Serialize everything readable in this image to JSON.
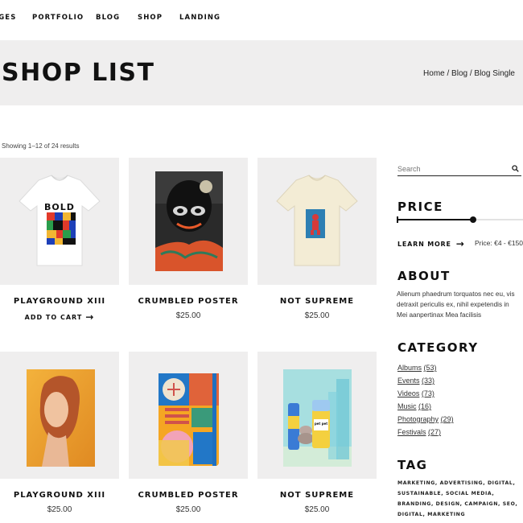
{
  "nav": {
    "items": [
      {
        "label": "PAGES"
      },
      {
        "label": "PORTFOLIO"
      },
      {
        "label": "BLOG"
      },
      {
        "label": "SHOP"
      },
      {
        "label": "LANDING"
      }
    ]
  },
  "hero": {
    "title": "SHOP LIST",
    "breadcrumb": "Home / Blog / Blog Single"
  },
  "results": "Showing 1–12 of 24 results",
  "products": [
    {
      "title": "PLAYGROUND XIII",
      "add_to_cart": "ADD TO CART",
      "shirt_text": "BOLD"
    },
    {
      "title": "CRUMBLED POSTER",
      "price": "$25.00"
    },
    {
      "title": "NOT SUPREME",
      "price": "$25.00"
    },
    {
      "title": "PLAYGROUND XIII",
      "price": "$25.00"
    },
    {
      "title": "CRUMBLED POSTER",
      "price": "$25.00"
    },
    {
      "title": "NOT SUPREME",
      "price": "$25.00",
      "can_text": "pet pet"
    }
  ],
  "sidebar": {
    "search": {
      "placeholder": "Search",
      "icon": "search-icon"
    },
    "price": {
      "heading": "PRICE",
      "learn_more": "LEARN MORE",
      "text": "Price: €4 - €150",
      "min": 4,
      "max": 150,
      "handle_positions": [
        0.0,
        0.6
      ]
    },
    "about": {
      "heading": "ABOUT",
      "text": "Alienum phaedrum torquatos nec eu, vis detraxit periculis ex, nihil expetendis in Mei aanpertinax Mea facilisis"
    },
    "category": {
      "heading": "CATEGORY",
      "items": [
        {
          "label": "Albums",
          "count": "(53)"
        },
        {
          "label": "Events",
          "count": "(33)"
        },
        {
          "label": "Videos",
          "count": "(73)"
        },
        {
          "label": "Music",
          "count": "(16)"
        },
        {
          "label": "Photography",
          "count": "(29)"
        },
        {
          "label": "Festivals",
          "count": "(27)"
        }
      ]
    },
    "tag": {
      "heading": "TAG",
      "items": [
        "MARKETING",
        "ADVERTISING",
        "DIGITAL",
        "SUSTAINABLE",
        "SOCIAL",
        "MEDIA",
        "BRANDING",
        "DESIGN",
        "CAMPAIGN",
        "SEO",
        "DIGITAL",
        "MARKETING"
      ]
    }
  },
  "colors": {
    "background": "#ffffff",
    "panel": "#efeeee",
    "text": "#111111"
  }
}
